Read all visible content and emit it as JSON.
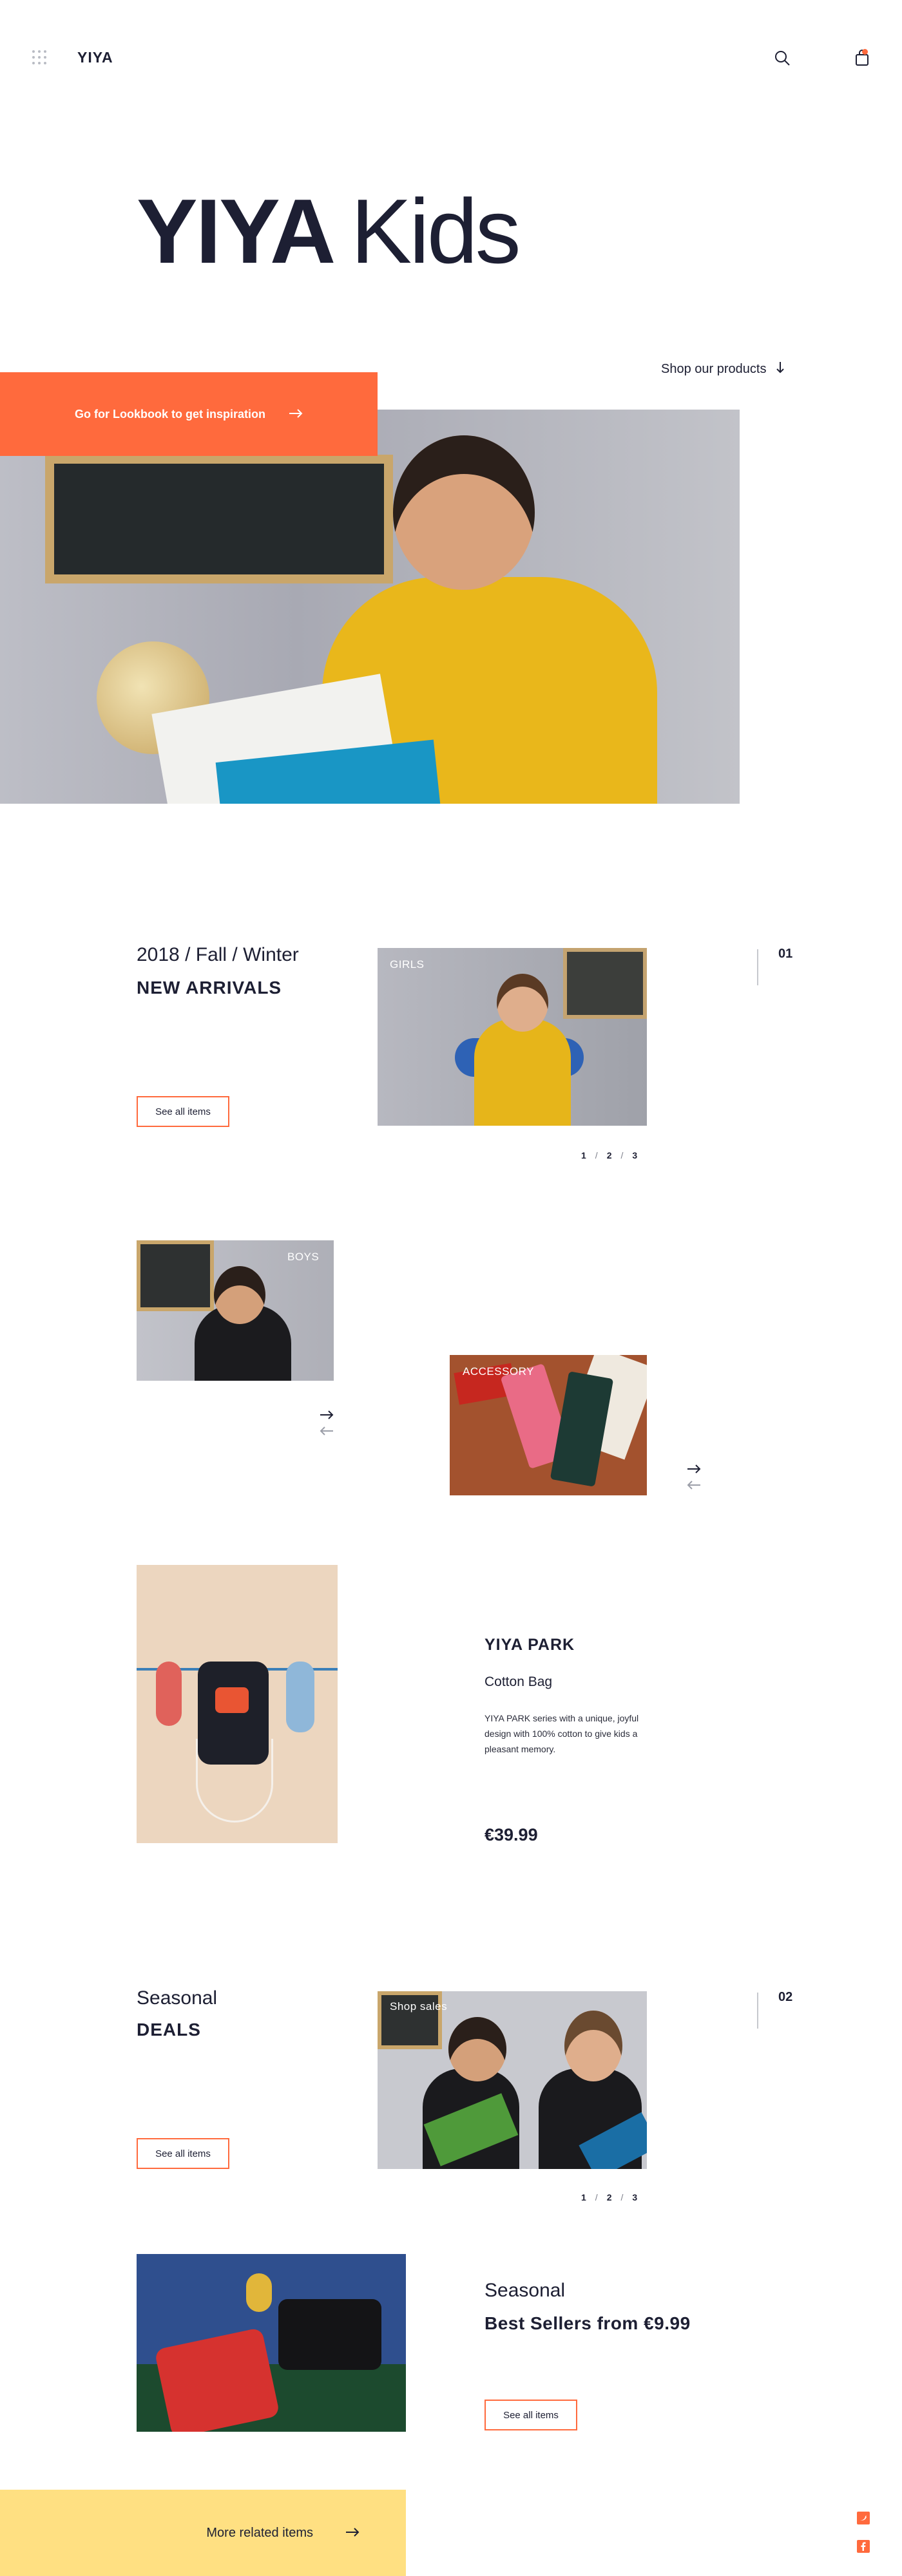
{
  "header": {
    "logo": "YIYA",
    "icons": [
      "menu-grid-icon",
      "search-icon",
      "shopping-bag-icon"
    ]
  },
  "hero": {
    "title_bold": "YIYA",
    "title_light": "Kids",
    "shop_link": "Shop our products",
    "lookbook_button": "Go for Lookbook to get inspiration"
  },
  "arrivals": {
    "season": "2018 / Fall / Winter",
    "title": "NEW ARRIVALS",
    "button": "See all items",
    "number": "01",
    "images": {
      "girls": "GIRLS",
      "boys": "BOYS",
      "accessory": "ACCESSORY"
    },
    "pager": [
      "1",
      "2",
      "3"
    ],
    "pager_sep": "/"
  },
  "product": {
    "brand": "YIYA PARK",
    "name": "Cotton Bag",
    "description": "YIYA PARK series with a unique, joyful design with 100% cotton to give kids a pleasant memory.",
    "price": "€39.99"
  },
  "deals": {
    "season": "Seasonal",
    "title": "DEALS",
    "button": "See all items",
    "number": "02",
    "image_label": "Shop sales",
    "pager": [
      "1",
      "2",
      "3"
    ],
    "pager_sep": "/"
  },
  "best_sellers": {
    "season": "Seasonal",
    "title": "Best Sellers from €9.99",
    "button": "See all items"
  },
  "footer": {
    "more_button": "More related items",
    "social": [
      "twitter-icon",
      "facebook-icon"
    ]
  },
  "colors": {
    "accent": "#ff6a3d",
    "dark": "#1d1f33",
    "yellow": "#ffe082"
  }
}
